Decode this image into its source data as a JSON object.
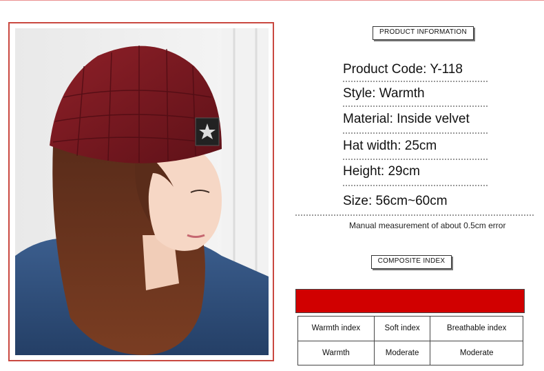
{
  "headers": {
    "product_information": "PRODUCT INFORMATION",
    "composite_index": "COMPOSITE INDEX"
  },
  "specs": {
    "product_code": "Product Code: Y-118",
    "style": "Style: Warmth",
    "material": "Material: Inside velvet",
    "hat_width": "Hat width: 25cm",
    "height": "Height: 29cm",
    "size": "Size: 56cm~60cm"
  },
  "note": "Manual measurement of about 0.5cm error",
  "index_table": {
    "headers": [
      "Warmth index",
      "Soft index",
      "Breathable index"
    ],
    "values": [
      "Warmth",
      "Moderate",
      "Moderate"
    ]
  },
  "colors": {
    "frame": "#c9473f",
    "bar": "#d10000",
    "hat": "#7a1a22"
  },
  "photo": {
    "badge_icon": "star-icon"
  }
}
